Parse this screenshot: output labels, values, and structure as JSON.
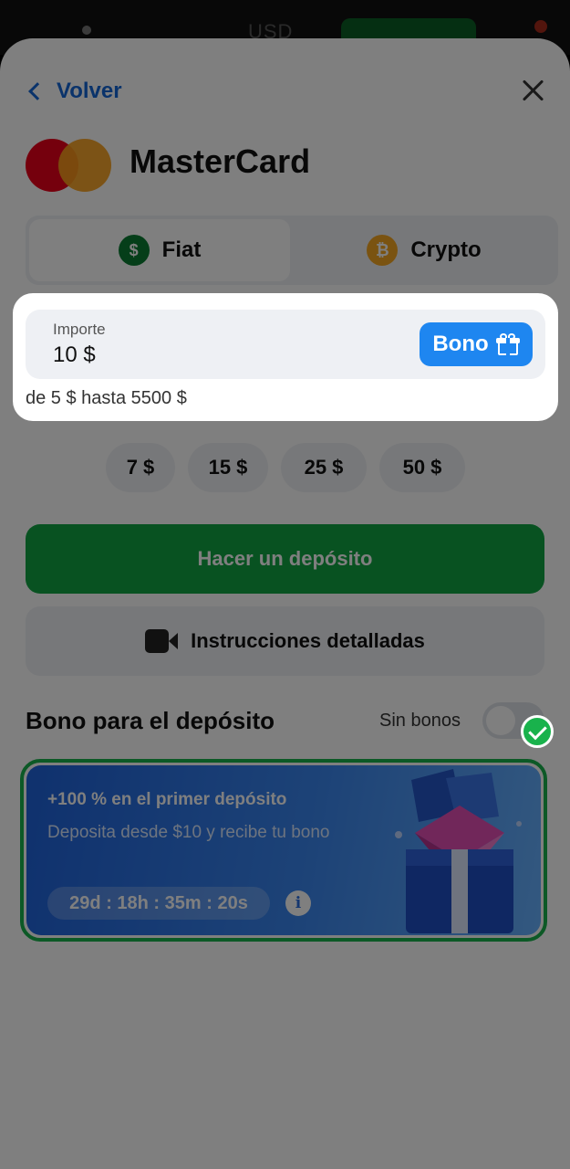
{
  "background": {
    "currency": "USD"
  },
  "header": {
    "back_label": "Volver",
    "method_title": "MasterCard"
  },
  "tabs": [
    {
      "label": "Fiat",
      "icon": "dollar-coin-icon",
      "symbol": "$",
      "color": "#0a7d33",
      "selected": true
    },
    {
      "label": "Crypto",
      "icon": "bitcoin-icon",
      "symbol": "₿",
      "color": "#f5a623",
      "selected": false
    }
  ],
  "amount": {
    "label": "Importe",
    "value": "10 $",
    "range": "de 5 $ hasta 5500 $",
    "bono_label": "Bono"
  },
  "quick_amounts": [
    "7 $",
    "15 $",
    "25 $",
    "50 $"
  ],
  "deposit_button": "Hacer un depósito",
  "instructions_button": "Instrucciones detalladas",
  "bonus": {
    "title": "Bono para el depósito",
    "no_bonus_label": "Sin bonos",
    "promo": {
      "title": "+100 % en el primer depósito",
      "description": "Deposita desde $10 y recibe tu bono",
      "timer": "29d : 18h : 35m : 20s",
      "selected": true
    }
  },
  "colors": {
    "accent_blue": "#1566d6",
    "deposit_green": "#11a543",
    "mastercard_red": "#eb001b",
    "mastercard_yellow": "#f79e1b"
  }
}
